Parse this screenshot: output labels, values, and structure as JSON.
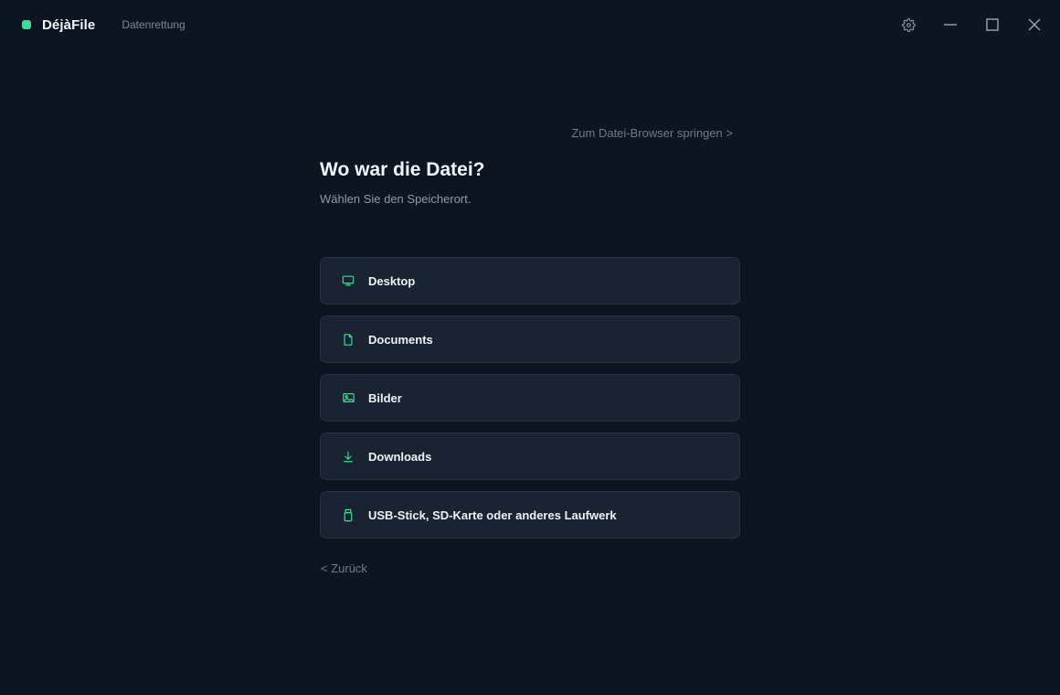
{
  "app": {
    "name": "DéjàFile",
    "section": "Datenrettung",
    "accent_color": "#3ddc97"
  },
  "window_controls": {
    "settings_icon": "gear-icon",
    "minimize_icon": "minimize-icon",
    "maximize_icon": "maximize-icon",
    "close_icon": "close-icon"
  },
  "main": {
    "browser_link": "Zum Datei-Browser springen >",
    "title": "Wo war die Datei?",
    "subtitle": "Wählen Sie den Speicherort.",
    "back_link": "< Zurück",
    "locations": [
      {
        "label": "Desktop",
        "icon": "monitor-icon"
      },
      {
        "label": "Documents",
        "icon": "document-icon"
      },
      {
        "label": "Bilder",
        "icon": "image-icon"
      },
      {
        "label": "Downloads",
        "icon": "download-icon"
      },
      {
        "label": "USB-Stick, SD-Karte oder anderes Laufwerk",
        "icon": "usb-drive-icon"
      }
    ]
  }
}
